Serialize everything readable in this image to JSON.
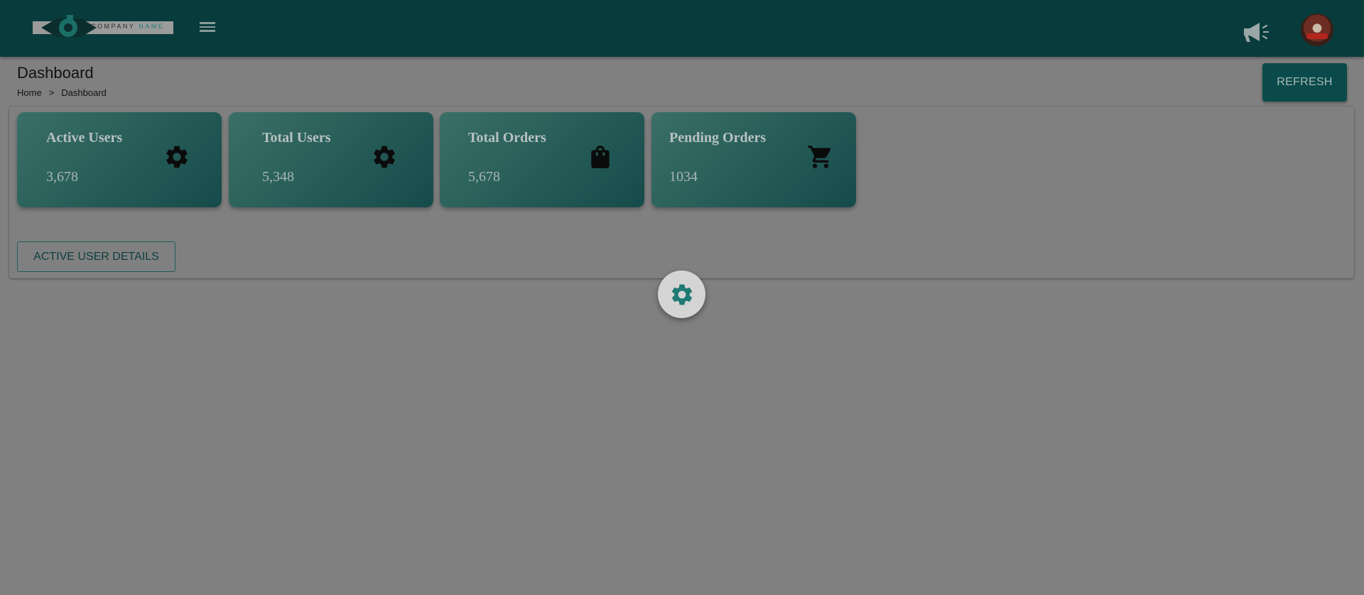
{
  "header": {
    "logo": {
      "brand": "COMPANY",
      "brand_accent": "NAME"
    },
    "icons": {
      "menu": "menu-icon",
      "announce": "megaphone-icon",
      "avatar": "avatar"
    }
  },
  "page": {
    "title": "Dashboard",
    "breadcrumb": [
      "Home",
      ">",
      "Dashboard"
    ],
    "refresh_label": "REFRESH"
  },
  "cards": [
    {
      "title": "Active Users",
      "value": "3,678",
      "icon": "gear-icon"
    },
    {
      "title": "Total Users",
      "value": "5,348",
      "icon": "gear-icon"
    },
    {
      "title": "Total Orders",
      "value": "5,678",
      "icon": "shopping-bag-icon"
    },
    {
      "title": "Pending Orders",
      "value": "1034",
      "icon": "shopping-cart-icon"
    }
  ],
  "actions": {
    "active_user_details": "ACTIVE USER DETAILS"
  },
  "fab": {
    "icon": "settings-gear-icon"
  },
  "colors": {
    "topbar": "#083b3c",
    "accent": "#0a4a4a",
    "card_start": "#3a6f67",
    "card_end": "#154b4a",
    "background": "#808080"
  }
}
